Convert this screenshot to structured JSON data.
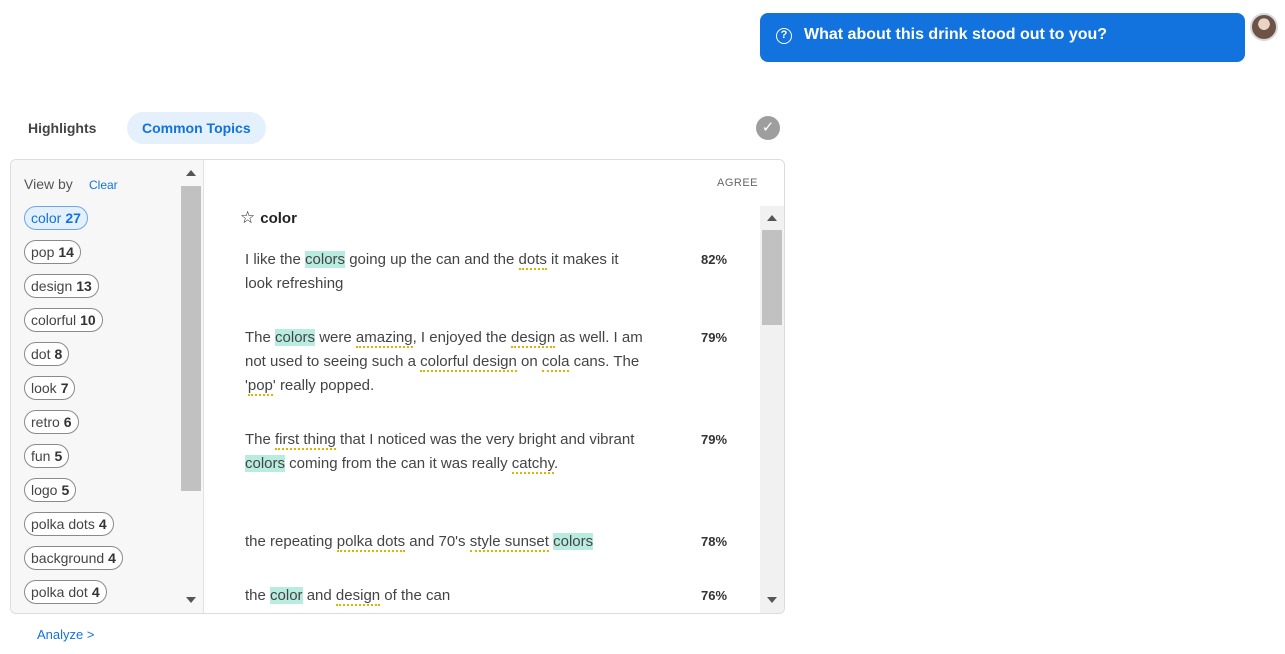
{
  "question": {
    "text": "What about this drink stood out to you?",
    "icon": "question-circle-icon"
  },
  "tabs": [
    {
      "label": "Highlights"
    },
    {
      "label": "Common Topics"
    }
  ],
  "sidebar": {
    "view_by": "View by",
    "clear": "Clear",
    "topics": [
      {
        "label": "color",
        "count": "27"
      },
      {
        "label": "pop",
        "count": "14"
      },
      {
        "label": "design",
        "count": "13"
      },
      {
        "label": "colorful",
        "count": "10"
      },
      {
        "label": "dot",
        "count": "8"
      },
      {
        "label": "look",
        "count": "7"
      },
      {
        "label": "retro",
        "count": "6"
      },
      {
        "label": "fun",
        "count": "5"
      },
      {
        "label": "logo",
        "count": "5"
      },
      {
        "label": "polka dots",
        "count": "4"
      },
      {
        "label": "background",
        "count": "4"
      },
      {
        "label": "polka dot",
        "count": "4"
      }
    ]
  },
  "main": {
    "agree_header": "AGREE",
    "topic_title": "color",
    "responses": [
      {
        "pct": "82%",
        "parts": [
          [
            "I like the ",
            ""
          ],
          [
            "colors",
            "hl"
          ],
          [
            " going up the can and the ",
            ""
          ],
          [
            "dots",
            "kw"
          ],
          [
            " it makes it look refreshing",
            ""
          ]
        ]
      },
      {
        "pct": "79%",
        "parts": [
          [
            "The ",
            ""
          ],
          [
            "colors",
            "hl"
          ],
          [
            " were ",
            ""
          ],
          [
            "amazing",
            "kw"
          ],
          [
            ", I enjoyed the ",
            ""
          ],
          [
            "design",
            "kw"
          ],
          [
            " as well. I am not used to seeing such a ",
            ""
          ],
          [
            "colorful design",
            "kw"
          ],
          [
            " on ",
            ""
          ],
          [
            "cola",
            "kw"
          ],
          [
            " cans. The '",
            ""
          ],
          [
            "pop",
            "kw"
          ],
          [
            "' really popped.",
            ""
          ]
        ]
      },
      {
        "pct": "79%",
        "parts": [
          [
            "The ",
            ""
          ],
          [
            "first thing",
            "kw"
          ],
          [
            " that I noticed was the very bright and vibrant ",
            ""
          ],
          [
            "colors",
            "hl"
          ],
          [
            " coming from the can it was really ",
            ""
          ],
          [
            "catchy",
            "kw"
          ],
          [
            ".",
            ""
          ]
        ]
      },
      {
        "pct": "78%",
        "parts": [
          [
            "the repeating ",
            ""
          ],
          [
            "polka dots",
            "kw"
          ],
          [
            " and 70's ",
            ""
          ],
          [
            "style sunset",
            "kw"
          ],
          [
            " ",
            ""
          ],
          [
            "colors",
            "hl"
          ]
        ]
      },
      {
        "pct": "76%",
        "parts": [
          [
            "the ",
            ""
          ],
          [
            "color",
            "hl"
          ],
          [
            " and ",
            ""
          ],
          [
            "design",
            "kw"
          ],
          [
            " of the can",
            ""
          ]
        ]
      }
    ]
  },
  "footer": {
    "analyze": "Analyze >"
  },
  "colors": {
    "accent": "#1273de",
    "highlight": "#b9ece0",
    "keyword_underline": "#e0b300"
  }
}
